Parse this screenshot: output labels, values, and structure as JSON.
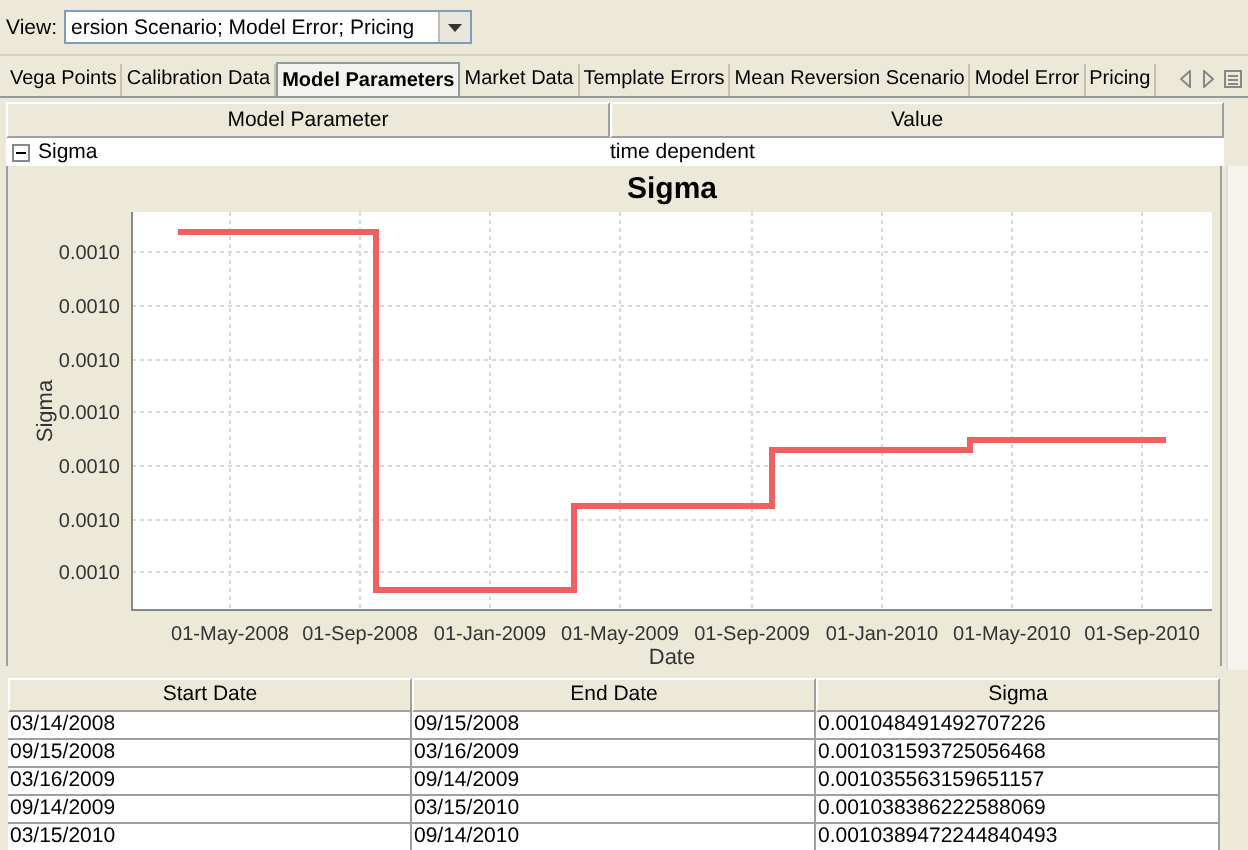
{
  "toolbar": {
    "label": "View:",
    "combo_value": "ersion Scenario; Model Error; Pricing"
  },
  "tabs": [
    {
      "label": "Vega Points",
      "selected": false
    },
    {
      "label": "Calibration Data",
      "selected": false
    },
    {
      "label": "Model Parameters",
      "selected": true
    },
    {
      "label": "Market Data",
      "selected": false
    },
    {
      "label": "Template Errors",
      "selected": false
    },
    {
      "label": "Mean Reversion Scenario",
      "selected": false
    },
    {
      "label": "Model Error",
      "selected": false
    },
    {
      "label": "Pricing",
      "selected": false
    }
  ],
  "parameter_table": {
    "columns": [
      "Model Parameter",
      "Value"
    ],
    "rows": [
      {
        "name": "Sigma",
        "value": "time dependent",
        "expanded": true
      }
    ]
  },
  "chart": {
    "title": "Sigma",
    "xlabel": "Date",
    "ylabel": "Sigma",
    "x_tick_labels": [
      "01-May-2008",
      "01-Sep-2008",
      "01-Jan-2009",
      "01-May-2009",
      "01-Sep-2009",
      "01-Jan-2010",
      "01-May-2010",
      "01-Sep-2010"
    ],
    "y_tick_labels": [
      "0.0010",
      "0.0010",
      "0.0010",
      "0.0010",
      "0.0010",
      "0.0010",
      "0.0010"
    ]
  },
  "sigma_table": {
    "columns": [
      "Start Date",
      "End Date",
      "Sigma"
    ],
    "rows": [
      [
        "03/14/2008",
        "09/15/2008",
        "0.001048491492707226"
      ],
      [
        "09/15/2008",
        "03/16/2009",
        "0.001031593725056468"
      ],
      [
        "03/16/2009",
        "09/14/2009",
        "0.001035563159651157"
      ],
      [
        "09/14/2009",
        "03/15/2010",
        "0.001038386222588069"
      ],
      [
        "03/15/2010",
        "09/14/2010",
        "0.0010389472244840493"
      ]
    ]
  }
}
